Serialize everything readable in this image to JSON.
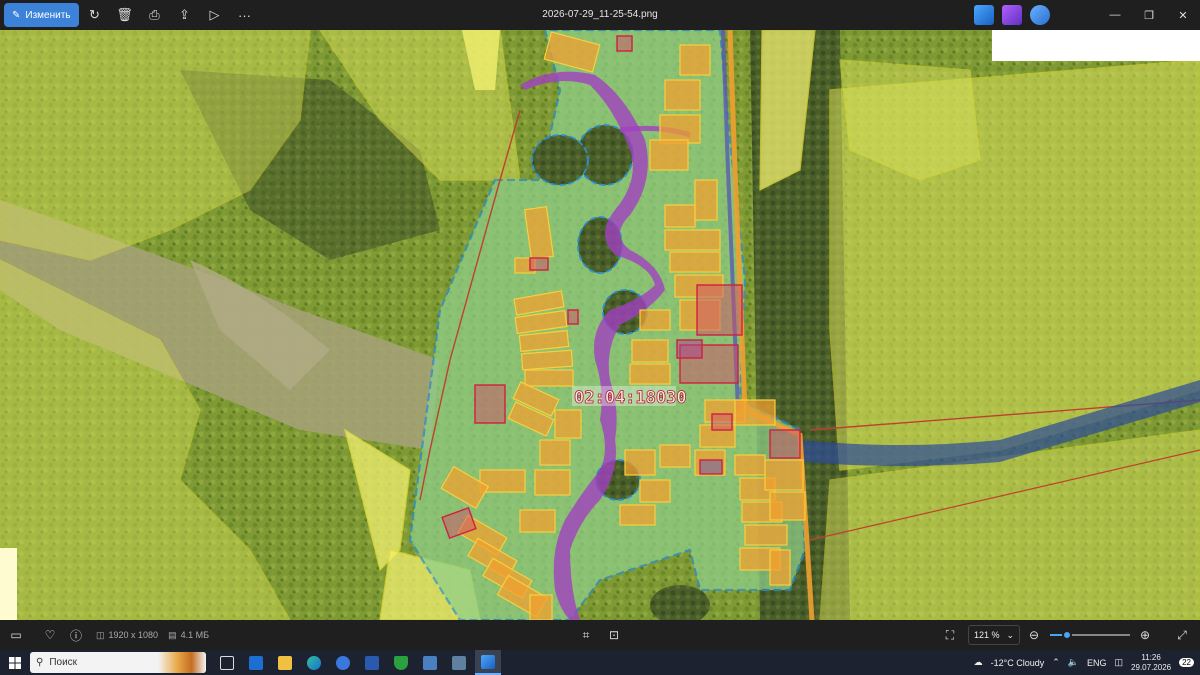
{
  "toolbar": {
    "edit_label": "Изменить",
    "filename": "2026-07-29_11-25-54.png"
  },
  "map": {
    "cadastral_label": "02:04:18030"
  },
  "bottombar": {
    "resolution": "1920 x 1080",
    "file_size": "4.1 МБ",
    "zoom": "121 %"
  },
  "taskbar": {
    "search_placeholder": "Поиск",
    "weather": "-12°C Cloudy",
    "language": "ENG",
    "time": "11:26",
    "date": "29.07.2026",
    "notification_count": "22"
  },
  "colors": {
    "accent": "#3b82d8",
    "parcel_orange": "#f0a030",
    "river_purple": "#a040c0",
    "zone_green": "#8fd08a",
    "zone_yellow": "#f2f070",
    "boundary_blue": "#2a8fd0"
  }
}
